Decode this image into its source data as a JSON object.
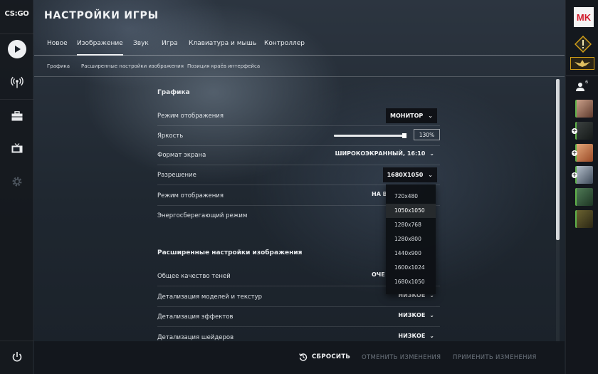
{
  "app": {
    "logo_text": "CS:GO",
    "page_title": "НАСТРОЙКИ ИГРЫ"
  },
  "tabs": [
    {
      "label": "Новое"
    },
    {
      "label": "Изображение",
      "active": true
    },
    {
      "label": "Звук"
    },
    {
      "label": "Игра"
    },
    {
      "label": "Клавиатура и мышь"
    },
    {
      "label": "Контроллер"
    }
  ],
  "subtabs": [
    {
      "label": "Графика"
    },
    {
      "label": "Расширенные настройки изображения"
    },
    {
      "label": "Позиция краёв интерфейса"
    }
  ],
  "graphics": {
    "title": "Графика",
    "display_mode": {
      "label": "Режим отображения",
      "value": "МОНИТОР"
    },
    "brightness": {
      "label": "Яркость",
      "value": "130%",
      "level": 0.95
    },
    "aspect_ratio": {
      "label": "Формат экрана",
      "value": "ШИРОКОЭКРАННЫЙ, 16:10"
    },
    "resolution": {
      "label": "Разрешение",
      "value": "1680X1050",
      "options": [
        "720x480",
        "1050x1050",
        "1280x768",
        "1280x800",
        "1440x900",
        "1600x1024",
        "1680x1050"
      ]
    },
    "display_mode_2": {
      "label": "Режим отображения",
      "value": "НА В"
    },
    "power_saving": {
      "label": "Энергосберегающий режим"
    }
  },
  "advanced": {
    "title": "Расширенные настройки изображения",
    "shadow_quality": {
      "label": "Общее качество теней",
      "value": "ОЧЕ"
    },
    "model_detail": {
      "label": "Детализация моделей и текстур",
      "value": "НИЗКОЕ"
    },
    "effect_detail": {
      "label": "Детализация эффектов",
      "value": "НИЗКОЕ"
    },
    "shader_detail": {
      "label": "Детализация шейдеров",
      "value": "НИЗКОЕ"
    }
  },
  "footer": {
    "reset": "СБРОСИТЬ",
    "cancel": "ОТМЕНИТЬ ИЗМЕНЕНИЯ",
    "apply": "ПРИМЕНИТЬ ИЗМЕНЕНИЯ"
  },
  "right_rail": {
    "avatar_text": "MK",
    "friends_count": "6"
  },
  "colors": {
    "avatar_red": "#d11a2a",
    "online_green": "#5fb34a",
    "rank_gold": "#d4a017"
  }
}
